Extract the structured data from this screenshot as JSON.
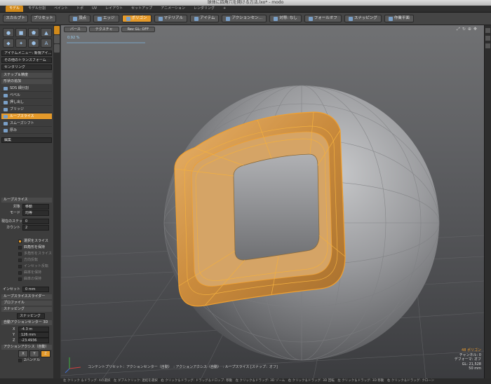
{
  "window": {
    "title": "球体に四角穴を開ける方法.lxo* - modo"
  },
  "tabs": [
    "モデル",
    "モデル分割",
    "ペイント",
    "トポ",
    "UV",
    "レイアウト",
    "セットアップ",
    "アニメーション",
    "レンダリング",
    "+"
  ],
  "toolbar": {
    "left": [
      "スカルプト",
      "プリセット"
    ],
    "items": [
      {
        "label": "頂点",
        "active": false
      },
      {
        "label": "エッジ",
        "active": false
      },
      {
        "label": "ポリゴン",
        "active": true
      },
      {
        "label": "マテリアル",
        "active": false
      },
      {
        "label": "アイテム",
        "active": false
      },
      {
        "label": "アクションセン…",
        "active": false
      },
      {
        "label": "対称: なし",
        "active": false
      },
      {
        "label": "フォールオフ",
        "active": false
      },
      {
        "label": "スナッピング",
        "active": false
      },
      {
        "label": "作業平面",
        "active": false
      }
    ]
  },
  "left": {
    "item_menu": "アイテムメニュー: 新規アイ…",
    "transform": "その他のトランスフォーム",
    "centering": "センタリング",
    "step_section": "ステップ＆精度",
    "shape_section": "形状の追加",
    "tools": [
      {
        "label": "SDS 細分割",
        "sel": false
      },
      {
        "label": "ベベル",
        "sel": false
      },
      {
        "label": "押し出し",
        "sel": false
      },
      {
        "label": "ブリッジ",
        "sel": false
      },
      {
        "label": "ループスライス",
        "sel": true
      },
      {
        "label": "スムーズシフト",
        "sel": false
      },
      {
        "label": "厚み",
        "sel": false
      }
    ],
    "edit_dropdown": "編集",
    "props": {
      "header": "ループスライス",
      "target_label": "対象",
      "target_value": "移動",
      "mode_label": "モード",
      "mode_value": "均等",
      "count_step_label": "現在のステップ",
      "count_step_value": "0",
      "count_label": "カウント",
      "count_value": "2",
      "checks": [
        {
          "label": "選択をスライス",
          "on": true
        },
        {
          "label": "四角形を保持",
          "on": false
        },
        {
          "label": "多角形をスライス",
          "on": false
        },
        {
          "label": "方向反転",
          "on": false
        },
        {
          "label": "インセット反転",
          "on": false
        },
        {
          "label": "曲率を保持",
          "on": false
        },
        {
          "label": "曲率の保持",
          "on": false
        }
      ],
      "inset_label": "インセット",
      "inset_value": "0 mm"
    },
    "section_slider": "ループスライススライダー",
    "section_profile": "プロファイル",
    "section_snap": "スナッピング",
    "snap_value": "スナッピング",
    "section_action": "自動アクションセンター 3D",
    "coords": [
      {
        "axis": "X",
        "value": "-4.3 m"
      },
      {
        "axis": "Y",
        "value": "126 mm"
      },
      {
        "axis": "Z",
        "value": "-23.4936"
      }
    ],
    "section_axis": "アクションアクシス（自動）",
    "axis_buttons": [
      "X",
      "Y",
      "Z"
    ],
    "handles": "2ハンドル"
  },
  "viewport": {
    "tabs": [
      "パース",
      "テクスチャ",
      "Rev GL: OFF"
    ],
    "grid_label": "0.92 %",
    "hud": [
      "48 ポリゴン",
      "チャンネル: 0",
      "デフォーマ: オフ",
      "GL: 21,528",
      "50 mm"
    ],
    "info": "コンテントプリセット：アクションセンター（自動）　: アクションアクシス（自動）　: ループスライス [スナップ：オフ]"
  },
  "status": "左 クリック ＆ドラッグ: Xの選択　左 ダブルクリック: 連結を選択　右 クリック＆ドラッグ: ドラッグ＆ドロップ: 移動　左 クリック＆ドラッグ: 3D ゾーム　右 クリック＆ドラッグ: 3D 回転　左 クリック＆ドラッグ: 3D 移動　右 クリック＆ドラッグ: クローン"
}
